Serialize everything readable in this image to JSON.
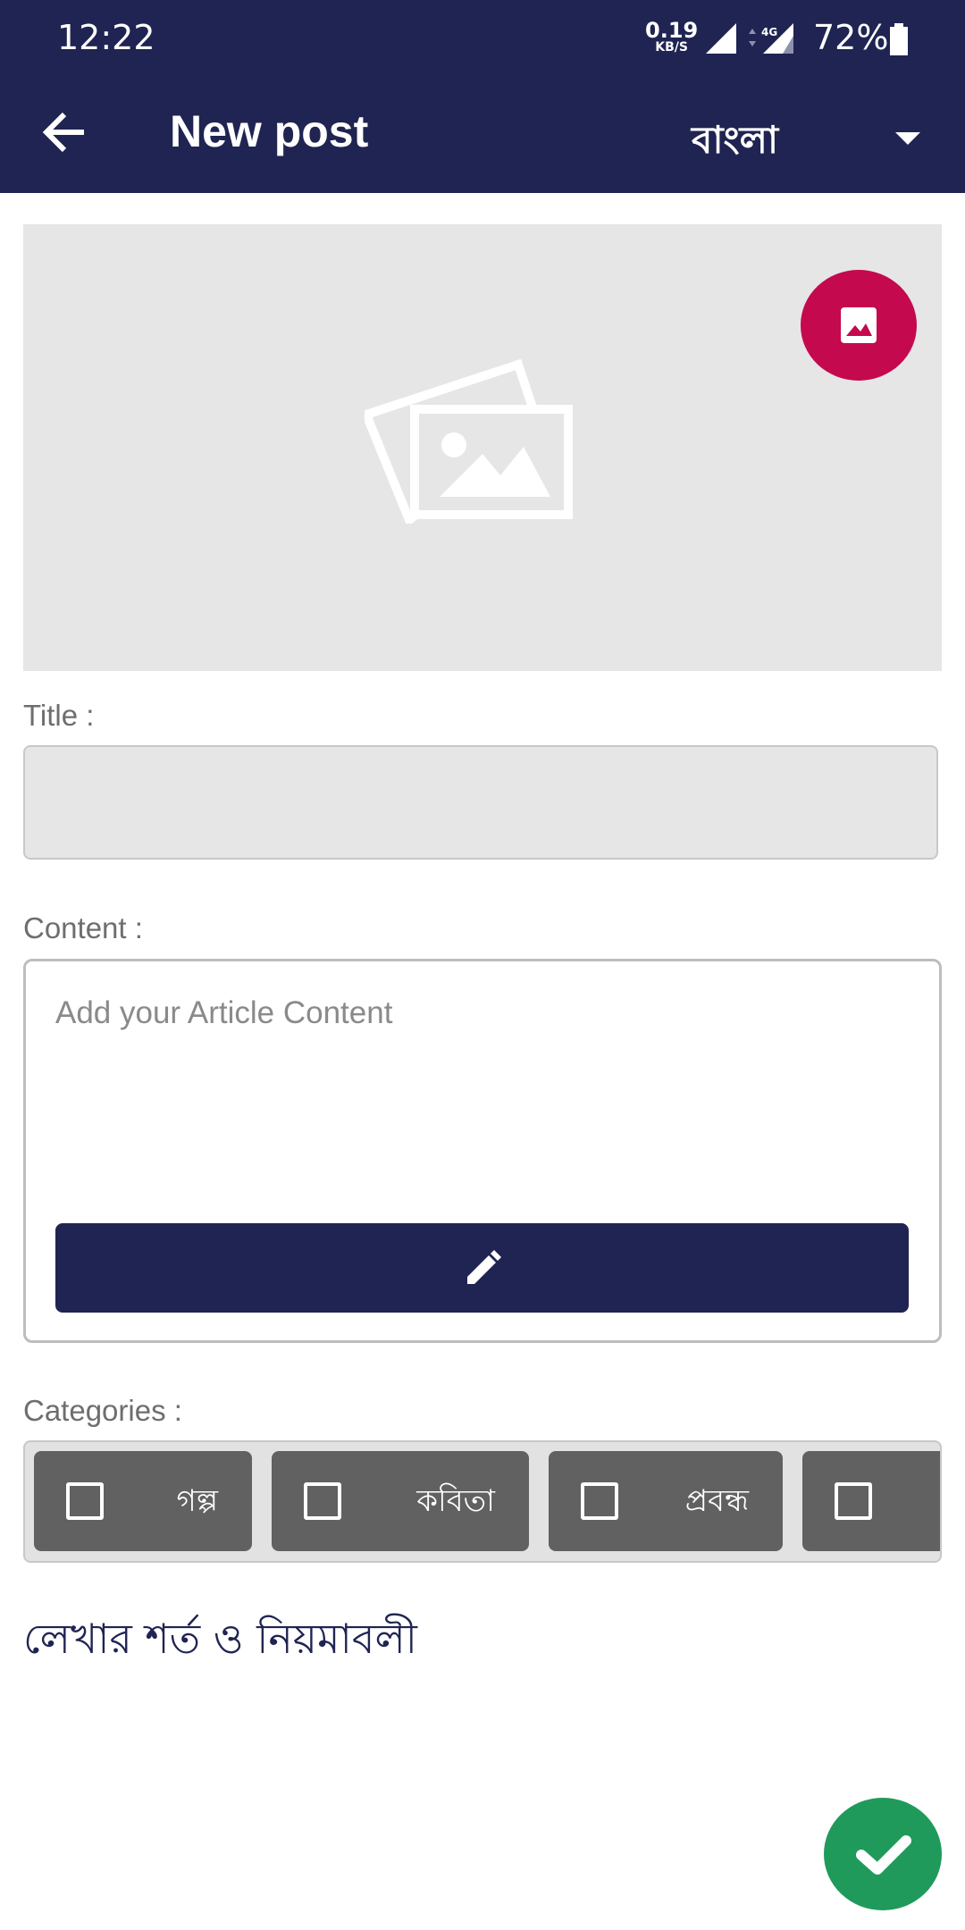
{
  "status_bar": {
    "time": "12:22",
    "net_speed_value": "0.19",
    "net_speed_unit": "KB/S",
    "network_type": "4G",
    "battery": "72%"
  },
  "app_bar": {
    "title": "New post",
    "language": "বাংলা"
  },
  "form": {
    "title_label": "Title :",
    "title_value": "",
    "content_label": "Content :",
    "content_placeholder": "Add your Article Content",
    "categories_label": "Categories :",
    "categories": [
      {
        "label": "গল্প",
        "checked": false
      },
      {
        "label": "কবিতা",
        "checked": false
      },
      {
        "label": "প্রবন্ধ",
        "checked": false
      },
      {
        "label": "",
        "checked": false
      }
    ],
    "terms_link": "লেখার শর্ত ও নিয়মাবলী"
  },
  "icons": {
    "back": "arrow-back-icon",
    "language_caret": "caret-down-icon",
    "pick_image": "image-icon",
    "placeholder": "photos-placeholder-icon",
    "edit": "pencil-icon",
    "submit": "checkmark-icon"
  },
  "colors": {
    "primary": "#1f2452",
    "accent": "#c4094f",
    "success": "#1f9a5a",
    "chip": "#616161"
  }
}
